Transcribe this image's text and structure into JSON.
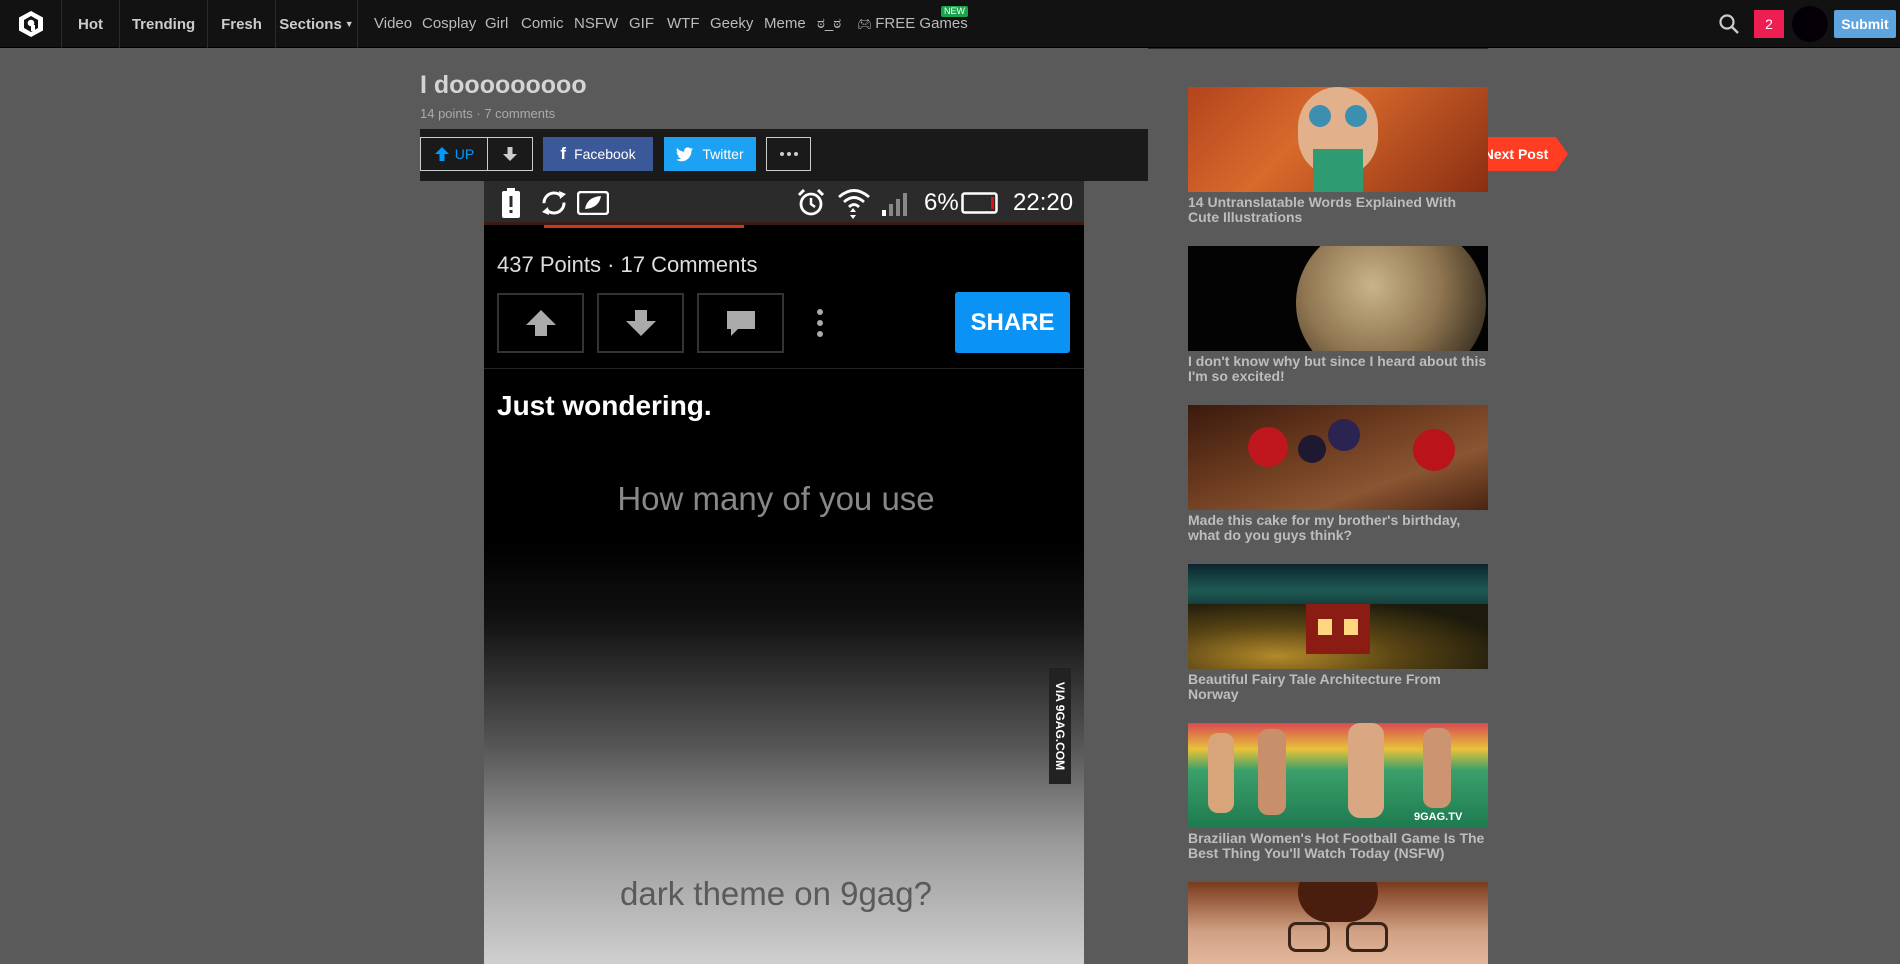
{
  "nav": {
    "main": [
      "Hot",
      "Trending",
      "Fresh",
      "Sections"
    ],
    "sections": [
      "Video",
      "Cosplay",
      "Girl",
      "Comic",
      "NSFW",
      "GIF",
      "WTF",
      "Geeky",
      "Meme",
      "ಠ_ಠ",
      "FREE Games"
    ],
    "new_badge": "NEW",
    "notification_count": "2",
    "submit_label": "Submit"
  },
  "post": {
    "title": "I dooooooooo",
    "points": "14 points",
    "separator": " · ",
    "comments": "7 comments",
    "up_label": "UP",
    "facebook_label": "Facebook",
    "twitter_label": "Twitter",
    "next_label": "Next Post"
  },
  "screenshot": {
    "battery_percent": "6%",
    "time": "22:20",
    "points_comments": "437 Points · 17 Comments",
    "share_label": "SHARE",
    "caption": "Just wondering.",
    "text1": "How many of you use",
    "text2": "dark theme on 9gag?",
    "watermark": "VIA 9GAG.COM"
  },
  "sidebar": [
    {
      "title": "14 Untranslatable Words Explained With Cute Illustrations",
      "image": "cartoon-girl"
    },
    {
      "title": "I don't know why but since I heard about this I'm so excited!",
      "image": "planet"
    },
    {
      "title": "Made this cake for my brother's birthday, what do you guys think?",
      "image": "cake"
    },
    {
      "title": "Beautiful Fairy Tale Architecture From Norway",
      "image": "cabin"
    },
    {
      "title": "Brazilian Women's Hot Football Game Is The Best Thing You'll Watch Today (NSFW)",
      "image": "football",
      "overlay": "9GAG.TV"
    },
    {
      "title": "",
      "image": "glasses-woman"
    }
  ],
  "colors": {
    "accent_blue": "#0099ff",
    "next_red": "#ff3d22",
    "facebook": "#3b5998",
    "twitter": "#1da1f2",
    "badge": "#ee1d52",
    "submit": "#5ea5e0"
  }
}
